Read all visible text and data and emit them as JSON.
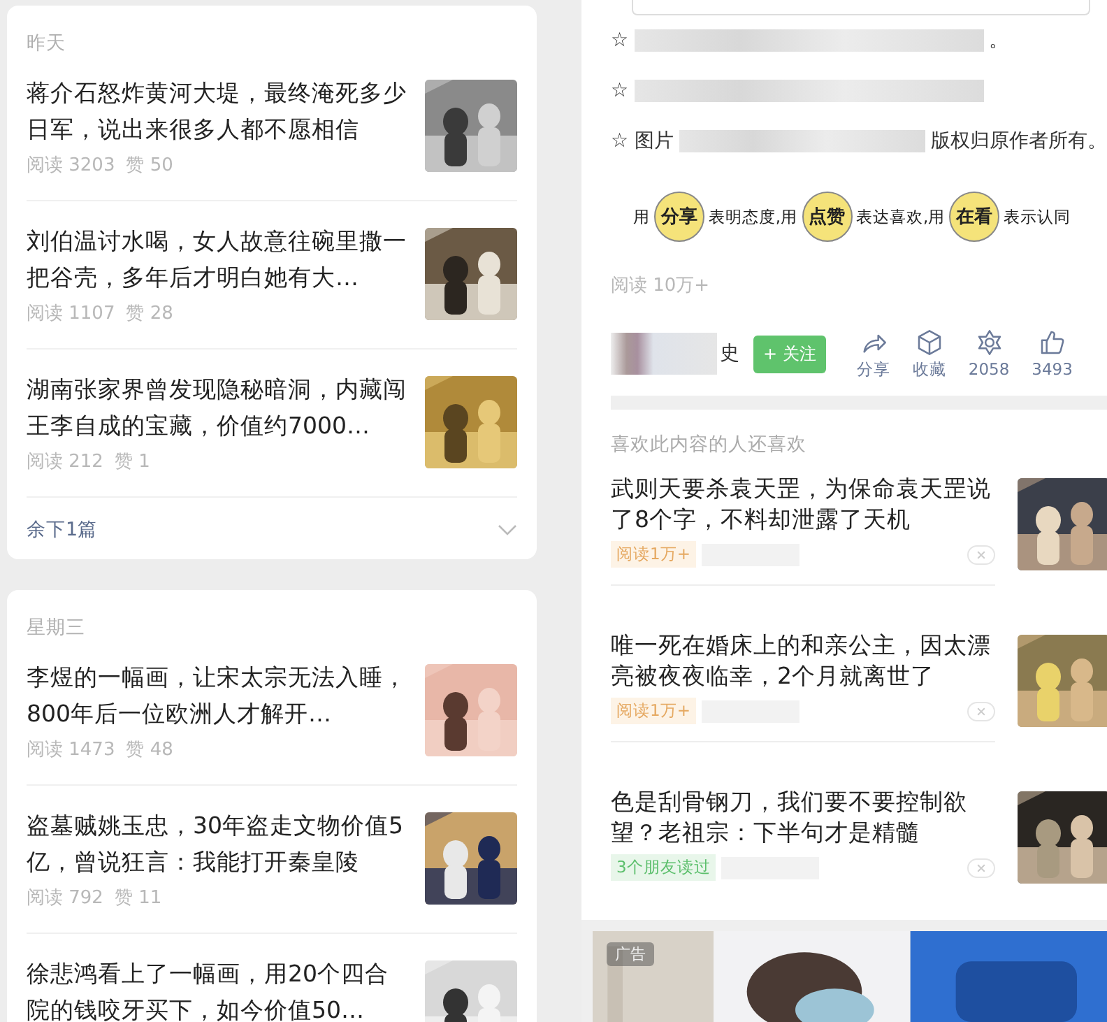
{
  "history": {
    "groups": [
      {
        "header": "昨天",
        "articles": [
          {
            "title": "蒋介石怒炸黄河大堤，最终淹死多少日军，说出来很多人都不愿相信",
            "reads": "阅读 3203",
            "likes": "赞 50"
          },
          {
            "title": "刘伯温讨水喝，女人故意往碗里撒一把谷壳，多年后才明白她有大…",
            "reads": "阅读 1107",
            "likes": "赞 28"
          },
          {
            "title": "湖南张家界曾发现隐秘暗洞，内藏闯王李自成的宝藏，价值约7000…",
            "reads": "阅读 212",
            "likes": "赞 1"
          }
        ],
        "more": "余下1篇"
      },
      {
        "header": "星期三",
        "articles": [
          {
            "title": "李煜的一幅画，让宋太宗无法入睡，800年后一位欧洲人才解开…",
            "reads": "阅读 1473",
            "likes": "赞 48"
          },
          {
            "title": "盗墓贼姚玉忠，30年盗走文物价值5亿，曾说狂言：我能打开秦皇陵",
            "reads": "阅读 792",
            "likes": "赞 11"
          },
          {
            "title": "徐悲鸿看上了一幅画，用20个四合院的钱咬牙买下，如今价值50…"
          }
        ]
      }
    ]
  },
  "article": {
    "notes": [
      {
        "lead": "☆",
        "tail": "。"
      },
      {
        "lead": "☆"
      },
      {
        "lead": "☆ 图片",
        "tail": "版权归原作者所有。"
      }
    ],
    "banner": [
      {
        "kind": "text",
        "text": "用"
      },
      {
        "kind": "badge",
        "text": "分享"
      },
      {
        "kind": "text",
        "text": "表明态度,用"
      },
      {
        "kind": "badge",
        "text": "点赞"
      },
      {
        "kind": "text",
        "text": "表达喜欢,用"
      },
      {
        "kind": "badge",
        "text": "在看"
      },
      {
        "kind": "text",
        "text": "表示认同"
      }
    ],
    "reads": "阅读 10万+",
    "author_tail": "史",
    "follow": "+ 关注",
    "actions": [
      {
        "kind": "share",
        "label": "分享"
      },
      {
        "kind": "collect",
        "label": "收藏"
      },
      {
        "kind": "wow",
        "label": "2058"
      },
      {
        "kind": "like",
        "label": "3493"
      }
    ]
  },
  "related": {
    "header": "喜欢此内容的人还喜欢",
    "items": [
      {
        "title": "武则天要杀袁天罡，为保命袁天罡说了8个字，不料却泄露了天机",
        "tag": "阅读1万+",
        "kind": "reads"
      },
      {
        "title": "唯一死在婚床上的和亲公主，因太漂亮被夜夜临幸，2个月就离世了",
        "tag": "阅读1万+",
        "kind": "reads"
      },
      {
        "title": "色是刮骨钢刀，我们要不要控制欲望？老祖宗：下半句才是精髓",
        "tag": "3个朋友读过",
        "kind": "friends"
      }
    ],
    "ad": {
      "label": "广告"
    }
  }
}
